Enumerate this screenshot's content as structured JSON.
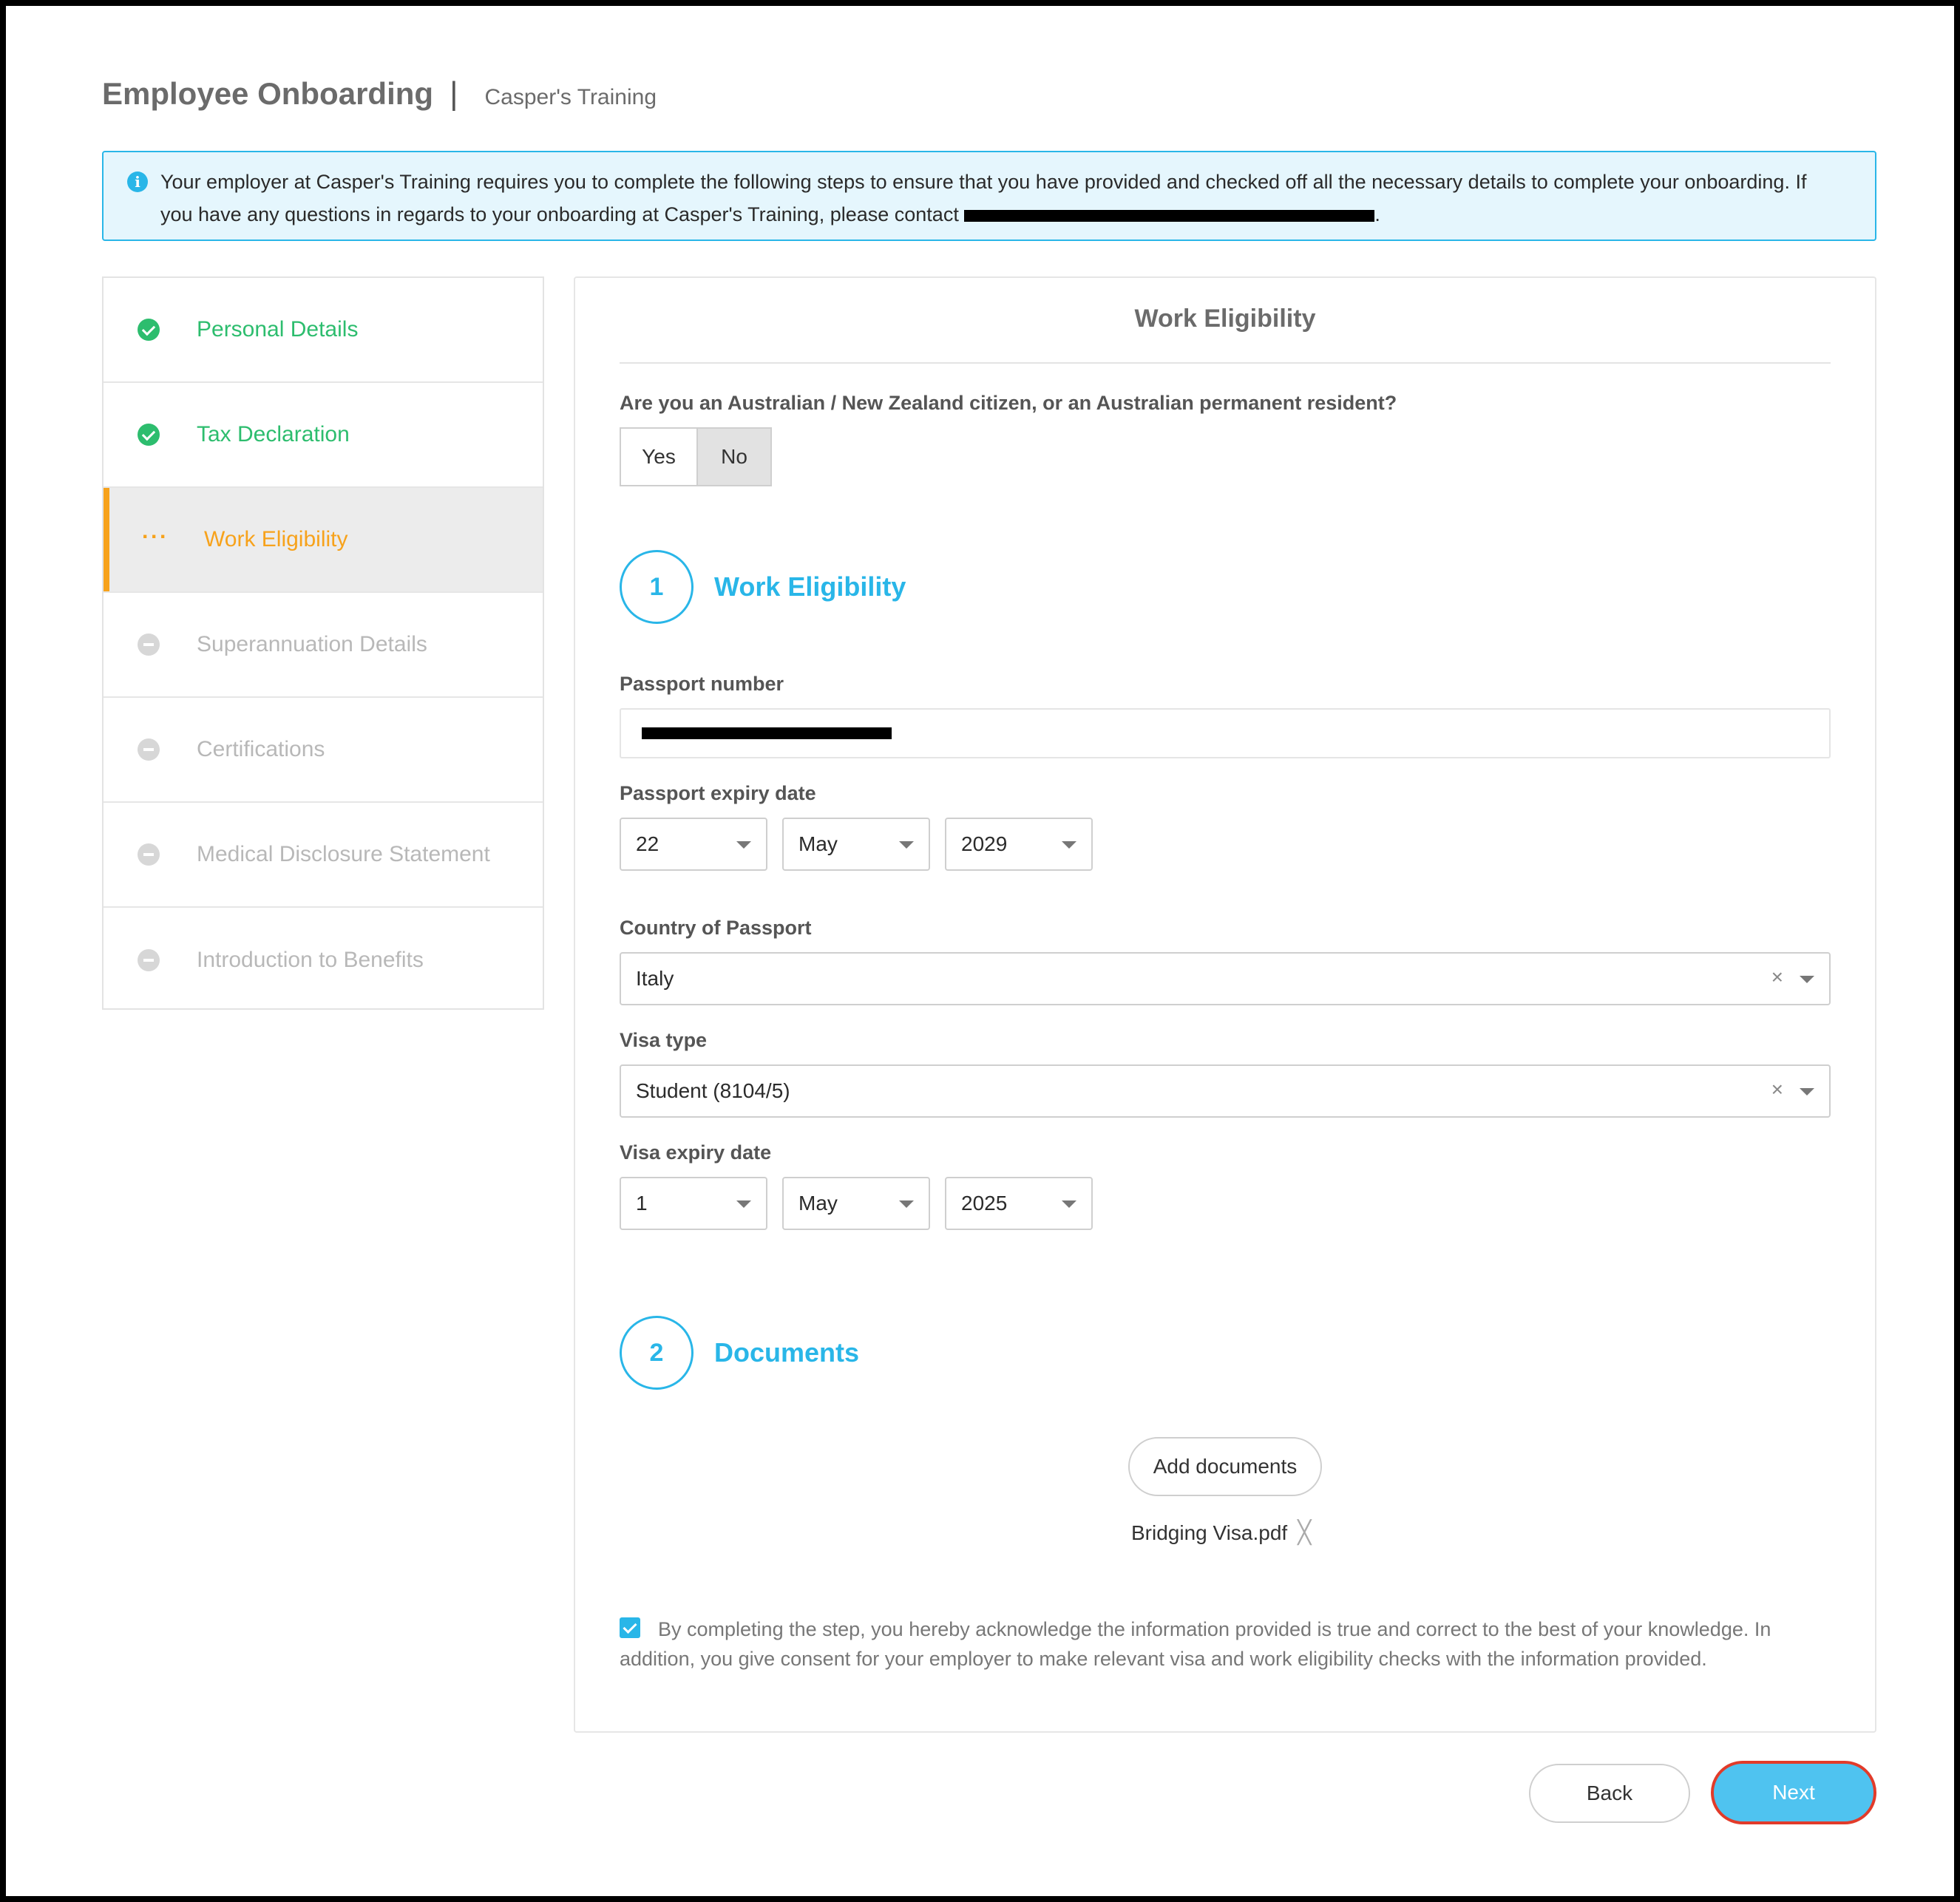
{
  "header": {
    "title": "Employee Onboarding",
    "separator": "|",
    "company": "Casper's Training"
  },
  "banner": {
    "text_prefix": "Your employer at Casper's Training requires you to complete the following steps to ensure that you have provided and checked off all the necessary details to complete your onboarding. If you have any questions in regards to your onboarding at Casper's Training, please contact ",
    "text_suffix": "."
  },
  "sidebar": {
    "steps": [
      {
        "label": "Personal Details",
        "status": "done"
      },
      {
        "label": "Tax Declaration",
        "status": "done"
      },
      {
        "label": "Work Eligibility",
        "status": "active"
      },
      {
        "label": "Superannuation Details",
        "status": "pending"
      },
      {
        "label": "Certifications",
        "status": "pending"
      },
      {
        "label": "Medical Disclosure Statement",
        "status": "pending"
      },
      {
        "label": "Introduction to Benefits",
        "status": "pending"
      }
    ],
    "active_dots": "···"
  },
  "panel": {
    "title": "Work Eligibility",
    "question": "Are you an Australian / New Zealand citizen, or an Australian permanent resident?",
    "yes_label": "Yes",
    "no_label": "No",
    "selected": "No",
    "section1": {
      "number": "1",
      "label": "Work Eligibility"
    },
    "passport_number_label": "Passport number",
    "passport_expiry_label": "Passport expiry date",
    "passport_expiry": {
      "day": "22",
      "month": "May",
      "year": "2029"
    },
    "country_label": "Country of Passport",
    "country_value": "Italy",
    "visa_type_label": "Visa type",
    "visa_type_value": "Student (8104/5)",
    "visa_expiry_label": "Visa expiry date",
    "visa_expiry": {
      "day": "1",
      "month": "May",
      "year": "2025"
    },
    "clear_glyph": "×",
    "section2": {
      "number": "2",
      "label": "Documents"
    },
    "add_documents_label": "Add documents",
    "file_name": "Bridging Visa.pdf",
    "file_remove_glyph": "╳",
    "acknowledgement": "By completing the step, you hereby acknowledge the information provided is true and correct to the best of your knowledge. In addition, you give consent for your employer to make relevant visa and work eligibility checks with the information provided.",
    "acknowledged": true
  },
  "footer": {
    "back_label": "Back",
    "next_label": "Next"
  },
  "icons": {
    "info": "info-icon",
    "done": "check-circle-icon",
    "pending": "minus-circle-icon",
    "caret": "chevron-down-icon",
    "clear": "close-icon"
  },
  "colors": {
    "accent": "#29b6e8",
    "success": "#2dbd6e",
    "active": "#f7a21b",
    "next_button": "#4fc3f0",
    "next_outline": "#e23b2a"
  }
}
